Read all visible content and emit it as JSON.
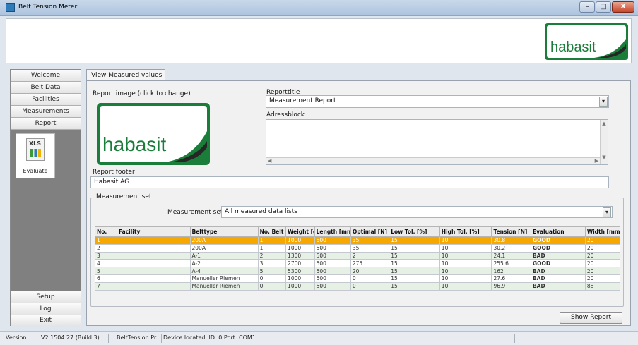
{
  "window": {
    "title": "Belt Tension Meter",
    "controls": [
      "–",
      "□",
      "X"
    ]
  },
  "brand": {
    "logo_text": "habasit",
    "colors": {
      "green": "#1a7e3a",
      "dark": "#262626",
      "white": "#ffffff"
    }
  },
  "sidebar": {
    "items": [
      {
        "label": "Welcome"
      },
      {
        "label": "Belt Data"
      },
      {
        "label": "Facilities"
      },
      {
        "label": "Measurements"
      },
      {
        "label": "Report"
      }
    ],
    "evaluate": {
      "icon_text": "XLS",
      "label": "Evaluate"
    },
    "bottom_items": [
      {
        "label": "Setup"
      },
      {
        "label": "Log"
      },
      {
        "label": "Exit"
      }
    ]
  },
  "tabs": [
    {
      "label": "View Measured values"
    }
  ],
  "report": {
    "image_label": "Report image (click to change)",
    "title_label": "Reporttitle",
    "title_value": "Measurement Report",
    "address_label": "Adressblock",
    "address_value": "",
    "footer_label": "Report footer",
    "footer_value": "Habasit AG"
  },
  "measurement": {
    "group_label": "Measurement set",
    "set_label": "Measurement set",
    "set_value": "All measured data lists",
    "columns": [
      "No.",
      "Facility",
      "Belttype",
      "No. Belt",
      "Weight [g/m",
      "Length [mm]",
      "Optimal [N]",
      "Low Tol. [%]",
      "High Tol. [%]",
      "Tension [N]",
      "Evaluation",
      "Width [mm"
    ],
    "rows": [
      [
        "1",
        "",
        "200A",
        "1",
        "1000",
        "500",
        "35",
        "15",
        "10",
        "30.8",
        "GOOD",
        "20"
      ],
      [
        "2",
        "",
        "200A",
        "1",
        "1000",
        "500",
        "35",
        "15",
        "10",
        "30.2",
        "GOOD",
        "20"
      ],
      [
        "3",
        "",
        "A-1",
        "2",
        "1300",
        "500",
        "2",
        "15",
        "10",
        "24.1",
        "BAD",
        "20"
      ],
      [
        "4",
        "",
        "A-2",
        "3",
        "2700",
        "500",
        "275",
        "15",
        "10",
        "255.6",
        "GOOD",
        "20"
      ],
      [
        "5",
        "",
        "A-4",
        "5",
        "5300",
        "500",
        "20",
        "15",
        "10",
        "162",
        "BAD",
        "20"
      ],
      [
        "6",
        "",
        "Manueller Riemen",
        "0",
        "1000",
        "500",
        "0",
        "15",
        "10",
        "27.6",
        "BAD",
        "20"
      ],
      [
        "7",
        "",
        "Manueller Riemen",
        "0",
        "1000",
        "500",
        "0",
        "15",
        "10",
        "96.9",
        "BAD",
        "88"
      ]
    ],
    "selected_row": 1
  },
  "actions": {
    "show_report": "Show Report"
  },
  "status": {
    "version_label": "Version",
    "version_value": "V2.1504.27 (Build 3)",
    "app_short": "BeltTension Pr",
    "device": "Device located. ID: 0  Port: COM1"
  }
}
